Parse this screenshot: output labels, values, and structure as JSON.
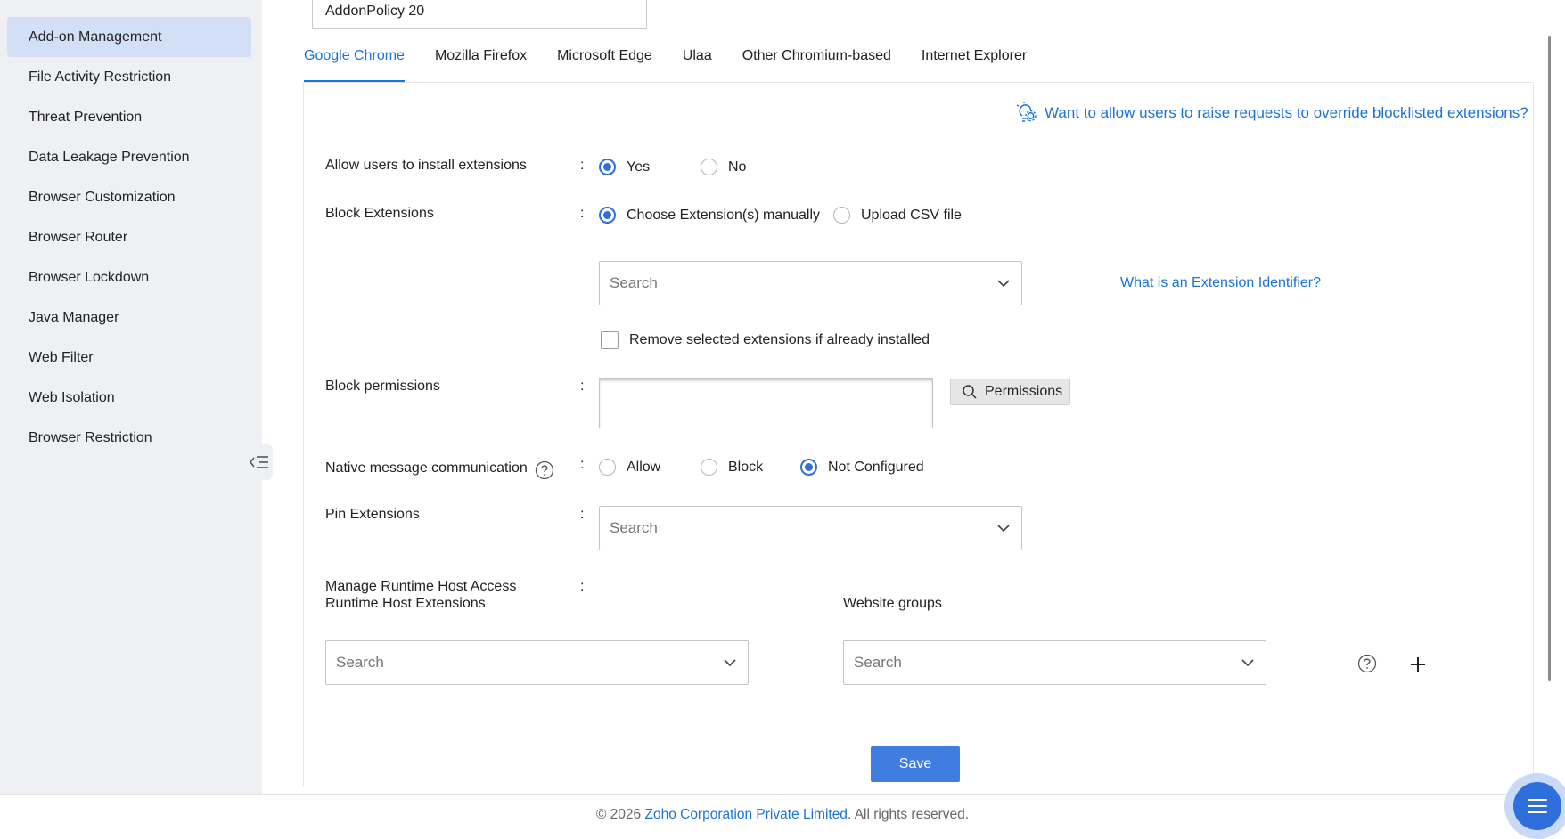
{
  "sidebar": {
    "items": [
      {
        "label": "Add-on Management",
        "active": true
      },
      {
        "label": "File Activity Restriction"
      },
      {
        "label": "Threat Prevention"
      },
      {
        "label": "Data Leakage Prevention"
      },
      {
        "label": "Browser Customization"
      },
      {
        "label": "Browser Router"
      },
      {
        "label": "Browser Lockdown"
      },
      {
        "label": "Java Manager"
      },
      {
        "label": "Web Filter"
      },
      {
        "label": "Web Isolation"
      },
      {
        "label": "Browser Restriction"
      }
    ]
  },
  "policy_name": "AddonPolicy 20",
  "tabs": [
    "Google Chrome",
    "Mozilla Firefox",
    "Microsoft Edge",
    "Ulaa",
    "Other Chromium-based",
    "Internet Explorer"
  ],
  "active_tab": "Google Chrome",
  "top_link": "Want to allow users to raise requests to override blocklisted extensions?",
  "form": {
    "colon": ":",
    "allow_install": {
      "label": "Allow users to install extensions",
      "yes": "Yes",
      "no": "No",
      "selected": "Yes"
    },
    "block_extensions": {
      "label": "Block Extensions",
      "manual": "Choose Extension(s) manually",
      "csv": "Upload CSV file",
      "selected": "Choose Extension(s) manually",
      "search_placeholder": "Search",
      "identifier_link": "What is an Extension Identifier?",
      "remove_checkbox": "Remove selected extensions if already installed",
      "remove_checked": false
    },
    "block_permissions": {
      "label": "Block permissions",
      "button": "Permissions"
    },
    "native_message": {
      "label": "Native message communication",
      "allow": "Allow",
      "block": "Block",
      "not_configured": "Not Configured",
      "selected": "Not Configured"
    },
    "pin_extensions": {
      "label": "Pin Extensions",
      "search_placeholder": "Search"
    },
    "runtime": {
      "label_line1": "Manage Runtime Host Access",
      "label_line2": "Runtime Host Extensions",
      "website_groups": "Website groups",
      "ext_search_placeholder": "Search",
      "groups_search_placeholder": "Search"
    },
    "save": "Save"
  },
  "footer": {
    "prefix": "© 2026",
    "company": "Zoho Corporation Private Limited",
    "suffix": ". All rights reserved."
  },
  "colors": {
    "accent": "#1a73d9",
    "primary_button": "#3f7de0",
    "sidebar_active": "#d3def7",
    "sidebar_bg": "#eef0f4"
  }
}
